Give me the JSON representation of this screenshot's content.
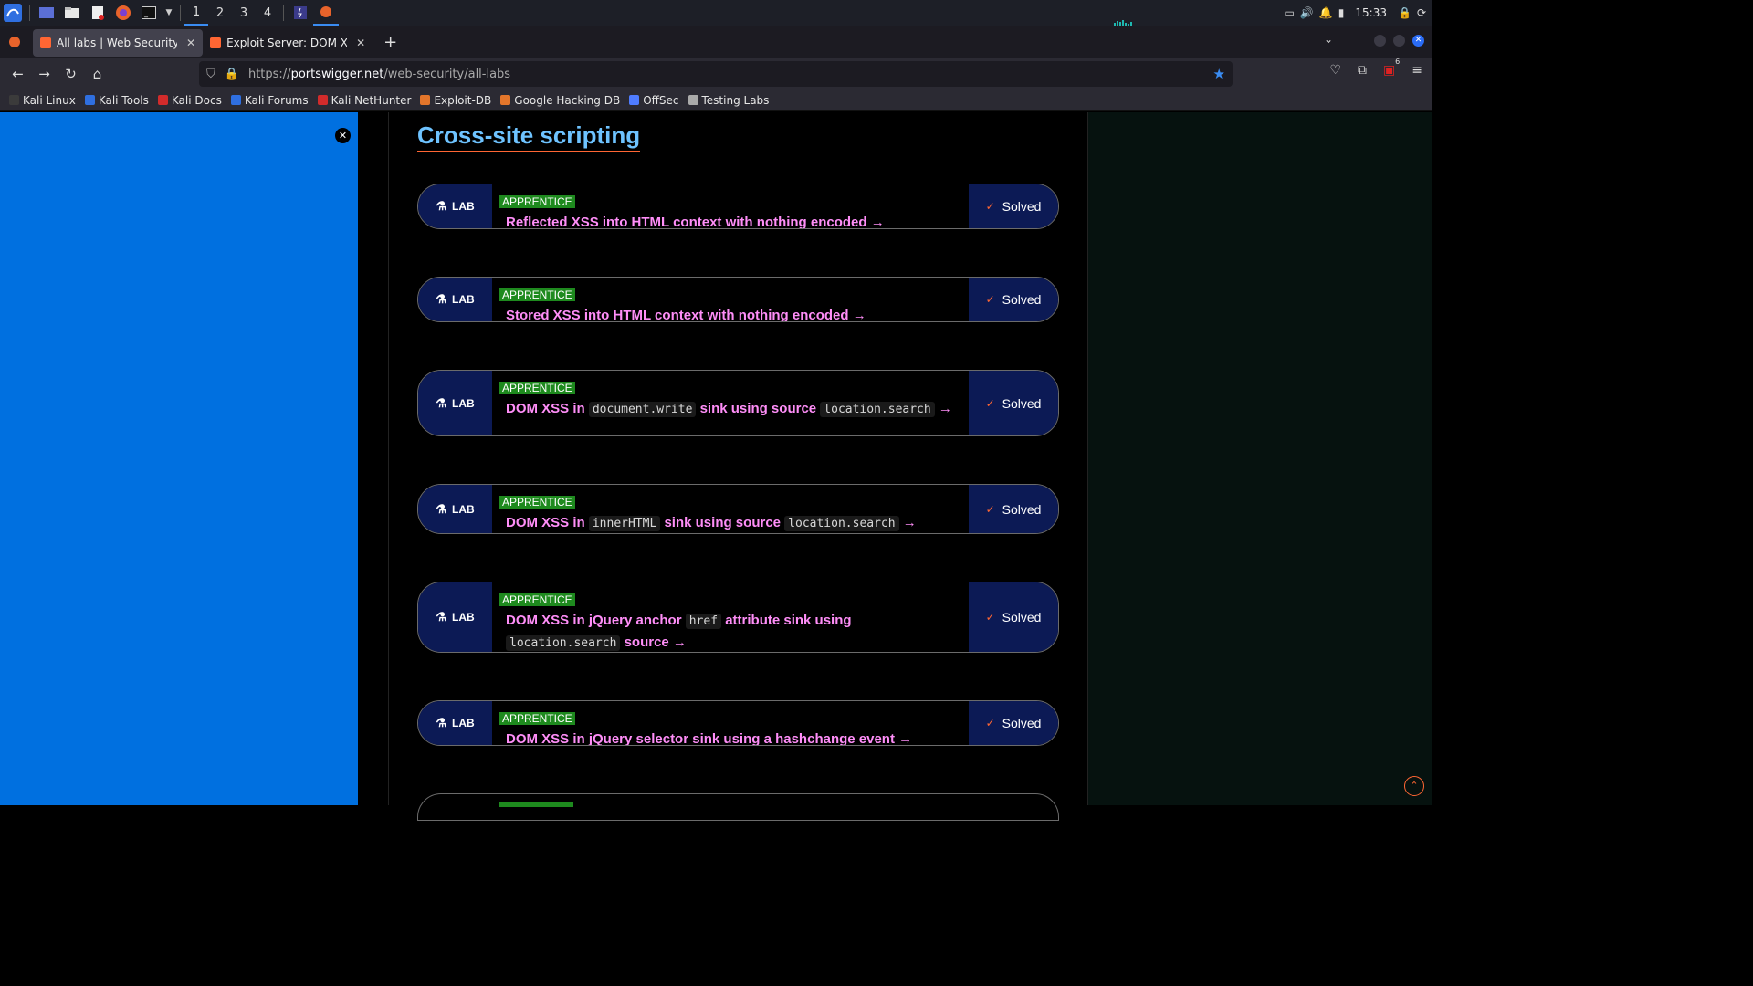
{
  "taskbar": {
    "workspaces": [
      "1",
      "2",
      "3",
      "4"
    ],
    "clock": "15:33"
  },
  "browser": {
    "tabs": [
      {
        "title": "All labs | Web Security Academy",
        "active": true
      },
      {
        "title": "Exploit Server: DOM XSS in jQuery selector",
        "active": false
      }
    ],
    "url_prefix": "https://",
    "url_domain": "portswigger.net",
    "url_path": "/web-security/all-labs",
    "addon_badge": "6"
  },
  "bookmarks": [
    {
      "label": "Kali Linux",
      "color": "#3b3b3b"
    },
    {
      "label": "Kali Tools",
      "color": "#2f6fe0"
    },
    {
      "label": "Kali Docs",
      "color": "#d22b2b"
    },
    {
      "label": "Kali Forums",
      "color": "#2f6fe0"
    },
    {
      "label": "Kali NetHunter",
      "color": "#d22b2b"
    },
    {
      "label": "Exploit-DB",
      "color": "#e3762b"
    },
    {
      "label": "Google Hacking DB",
      "color": "#e3762b"
    },
    {
      "label": "OffSec",
      "color": "#4f7cff"
    },
    {
      "label": "Testing Labs",
      "color": "#aaaaaa"
    }
  ],
  "page": {
    "section_title": "Cross-site scripting",
    "lab_label": "LAB",
    "status_label": "Solved",
    "labs": [
      {
        "level": "APPRENTICE",
        "parts": [
          {
            "t": "Reflected XSS into HTML context with nothing encoded"
          }
        ]
      },
      {
        "level": "APPRENTICE",
        "parts": [
          {
            "t": "Stored XSS into HTML context with nothing encoded"
          }
        ]
      },
      {
        "level": "APPRENTICE",
        "parts": [
          {
            "t": "DOM XSS in "
          },
          {
            "c": "document.write"
          },
          {
            "t": " sink using source "
          },
          {
            "c": "location.search"
          }
        ]
      },
      {
        "level": "APPRENTICE",
        "parts": [
          {
            "t": "DOM XSS in "
          },
          {
            "c": "innerHTML"
          },
          {
            "t": " sink using source "
          },
          {
            "c": "location.search"
          }
        ]
      },
      {
        "level": "APPRENTICE",
        "parts": [
          {
            "t": "DOM XSS in jQuery anchor "
          },
          {
            "c": "href"
          },
          {
            "t": " attribute sink using "
          },
          {
            "c": "location.search"
          },
          {
            "t": " source"
          }
        ]
      },
      {
        "level": "APPRENTICE",
        "parts": [
          {
            "t": "DOM XSS in jQuery selector sink using a hashchange event"
          }
        ]
      }
    ]
  },
  "colors": {
    "panel_blue": "#0070e0",
    "lab_navy": "#0c1a55",
    "title_pink": "#ff8ef8",
    "level_green": "#1e8a1e",
    "accent_orange": "#ff6633",
    "heading_blue": "#6ec3ff"
  },
  "icons": [
    "kali-menu-icon",
    "flask-icon",
    "check-icon",
    "close-icon",
    "star-icon",
    "scroll-top-icon"
  ]
}
